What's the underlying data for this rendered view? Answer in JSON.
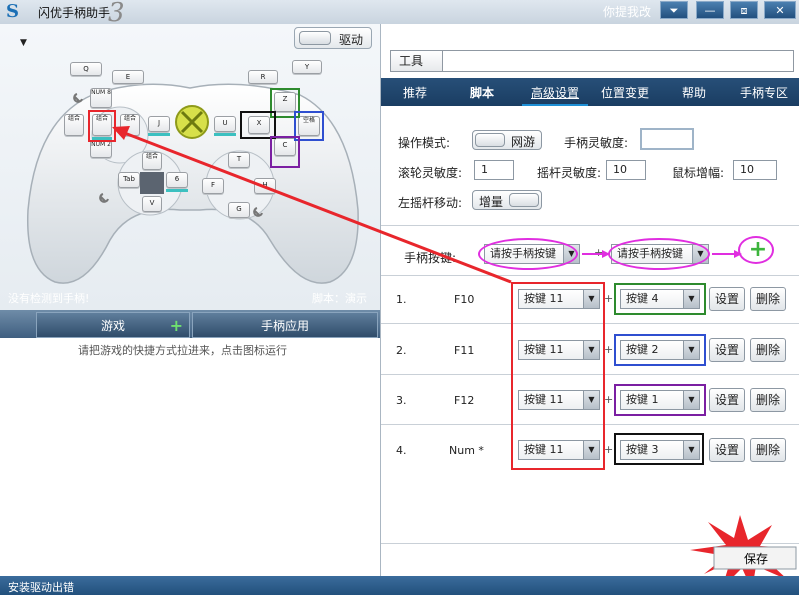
{
  "window": {
    "title": "闪优手柄助手",
    "title_suffix": "3",
    "feedback": "你提我改",
    "buttons": [
      "⏷",
      "—",
      "⧈",
      "✕"
    ]
  },
  "drive": {
    "label": "驱动"
  },
  "controller": {
    "keys": {
      "q": "Q",
      "e": "E",
      "num8": "NUM 8",
      "combo1": "组合",
      "combo2": "组合",
      "combo3": "组合",
      "num2": "NUM 2",
      "j": "J",
      "u": "U",
      "r": "R",
      "y": "Y",
      "z": "Z",
      "x": "X",
      "space": "空格",
      "c": "C",
      "tab": "Tab",
      "combo4": "组合",
      "six": "6",
      "v": "V",
      "t": "T",
      "f": "F",
      "h": "H",
      "g": "G"
    }
  },
  "left": {
    "status_no_controller": "没有检测到手柄!",
    "status_script": "脚本：演示",
    "tabs": [
      "游戏",
      "手柄应用"
    ],
    "drag_hint": "请把游戏的快捷方式拉进来，点击图标运行"
  },
  "right": {
    "tools_label": "工具",
    "tabs": [
      "推荐",
      "脚本",
      "高级设置",
      "位置变更",
      "帮助",
      "手柄专区"
    ],
    "mode_label": "操作模式:",
    "mode_value": "网游",
    "sensitivity_label": "手柄灵敏度:",
    "roller_label": "滚轮灵敏度:",
    "roller_value": "1",
    "stick_label": "摇杆灵敏度:",
    "stick_value": "10",
    "mouse_label": "鼠标增幅:",
    "mouse_value": "10",
    "left_stick_label": "左摇杆移动:",
    "left_stick_value": "增量",
    "combo_label": "手柄按键:",
    "combo_select1": "请按手柄按键",
    "combo_plus": "+",
    "combo_select2": "请按手柄按键",
    "rows": [
      {
        "num": "1.",
        "key": "F10",
        "a": "按键 11",
        "b": "按键 4"
      },
      {
        "num": "2.",
        "key": "F11",
        "a": "按键 11",
        "b": "按键 2"
      },
      {
        "num": "3.",
        "key": "F12",
        "a": "按键 11",
        "b": "按键 1"
      },
      {
        "num": "4.",
        "key": "Num *",
        "a": "按键 11",
        "b": "按键 3"
      }
    ],
    "set_label": "设置",
    "delete_label": "删除",
    "save_label": "保存"
  },
  "bottom": {
    "status": "安装驱动出错"
  },
  "colors": {
    "accent_red": "#e8262c",
    "magenta": "#e02ee0",
    "green": "#2e8b2e",
    "blue": "#2f4fd0",
    "purple": "#7b1fa2",
    "black": "#111111"
  }
}
